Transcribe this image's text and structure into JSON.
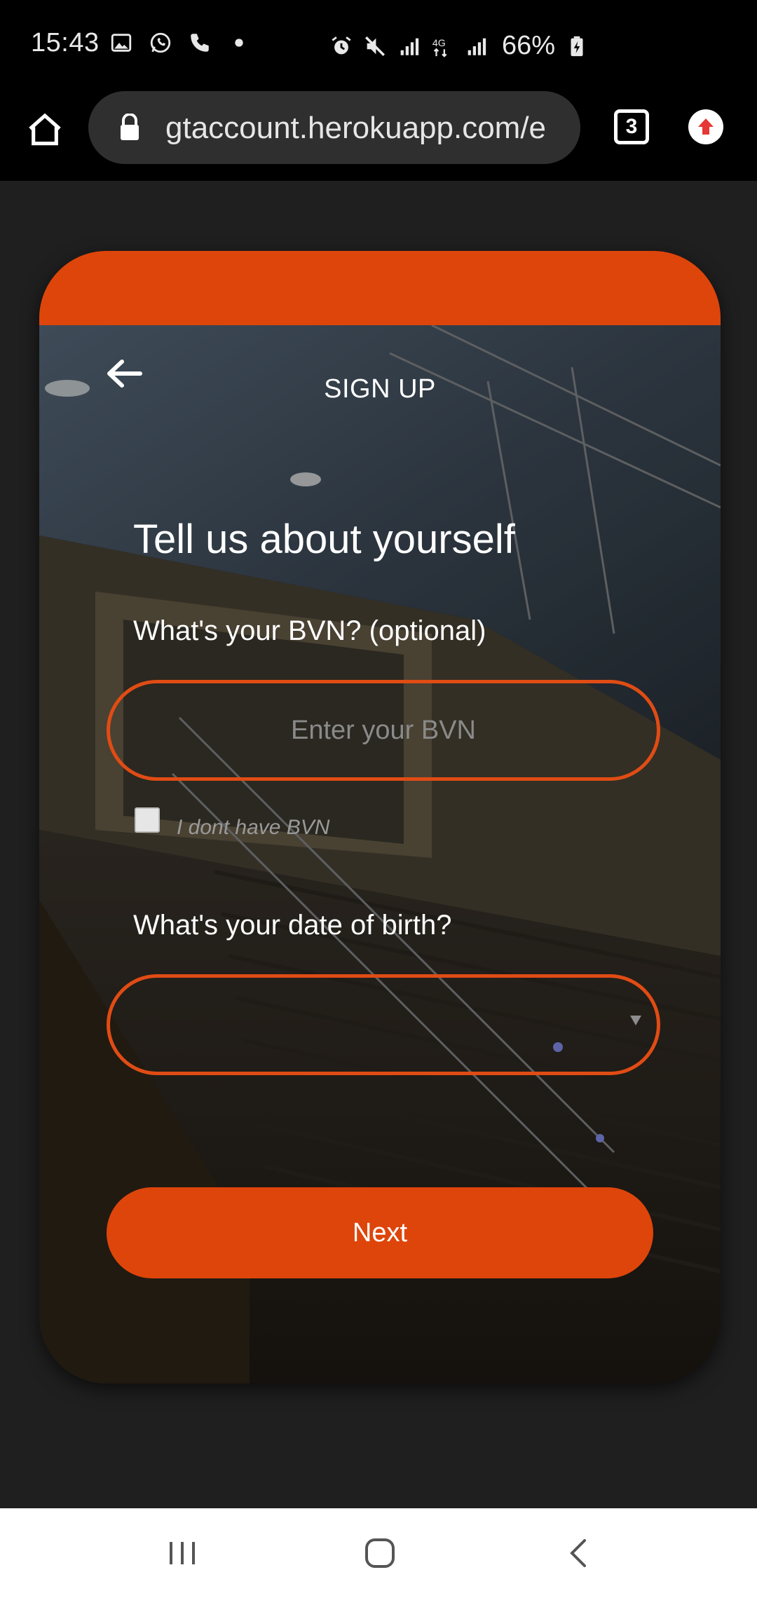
{
  "status_bar": {
    "time": "15:43",
    "battery": "66%",
    "icons": [
      "gallery-icon",
      "whatsapp-icon",
      "phone-icon",
      "dot-icon",
      "alarm-icon",
      "mute-icon",
      "signal-icon",
      "4g-icon",
      "signal-icon",
      "battery-charging-icon"
    ]
  },
  "browser": {
    "url": "gtaccount.herokuapp.com/e",
    "tab_count": "3"
  },
  "page": {
    "title": "SIGN UP",
    "heading": "Tell us about yourself",
    "bvn_label": "What's your BVN? (optional)",
    "bvn_placeholder": "Enter your BVN",
    "no_bvn_label": "I dont have BVN",
    "dob_label": "What's your date of birth?",
    "dob_value": "",
    "next_label": "Next"
  },
  "colors": {
    "accent": "#de450b",
    "background": "#1f1f1f"
  }
}
